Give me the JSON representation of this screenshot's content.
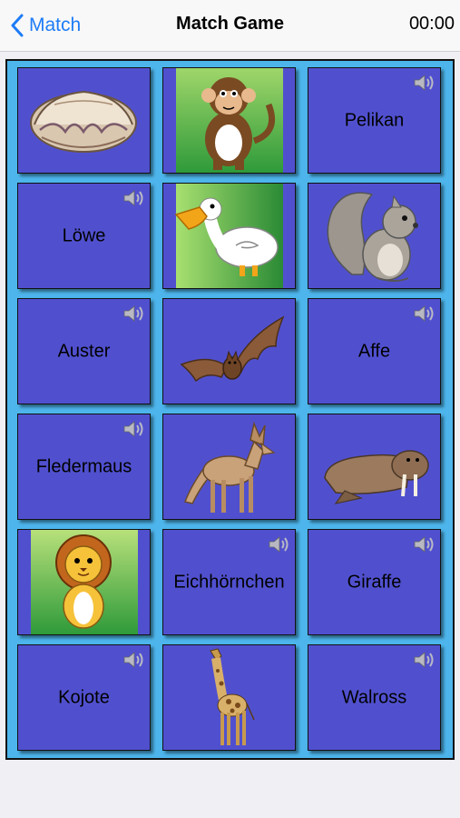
{
  "nav": {
    "back_label": "Match",
    "title": "Match Game",
    "timer": "00:00"
  },
  "colors": {
    "card": "#5050cf",
    "board": "#4db5eb",
    "accent": "#1e7cf6"
  },
  "cards": [
    {
      "kind": "image",
      "animal": "oyster",
      "icon": "oyster-image"
    },
    {
      "kind": "image",
      "animal": "monkey",
      "icon": "monkey-image"
    },
    {
      "kind": "word",
      "text": "Pelikan",
      "icon": "speaker-icon"
    },
    {
      "kind": "word",
      "text": "Löwe",
      "icon": "speaker-icon"
    },
    {
      "kind": "image",
      "animal": "pelican",
      "icon": "pelican-image"
    },
    {
      "kind": "image",
      "animal": "squirrel",
      "icon": "squirrel-image"
    },
    {
      "kind": "word",
      "text": "Auster",
      "icon": "speaker-icon"
    },
    {
      "kind": "image",
      "animal": "bat",
      "icon": "bat-image"
    },
    {
      "kind": "word",
      "text": "Affe",
      "icon": "speaker-icon"
    },
    {
      "kind": "word",
      "text": "Fledermaus",
      "icon": "speaker-icon"
    },
    {
      "kind": "image",
      "animal": "coyote",
      "icon": "coyote-image"
    },
    {
      "kind": "image",
      "animal": "walrus",
      "icon": "walrus-image"
    },
    {
      "kind": "image",
      "animal": "lion",
      "icon": "lion-image"
    },
    {
      "kind": "word",
      "text": "Eichhörnchen",
      "icon": "speaker-icon"
    },
    {
      "kind": "word",
      "text": "Giraffe",
      "icon": "speaker-icon"
    },
    {
      "kind": "word",
      "text": "Kojote",
      "icon": "speaker-icon"
    },
    {
      "kind": "image",
      "animal": "giraffe",
      "icon": "giraffe-image"
    },
    {
      "kind": "word",
      "text": "Walross",
      "icon": "speaker-icon"
    }
  ]
}
